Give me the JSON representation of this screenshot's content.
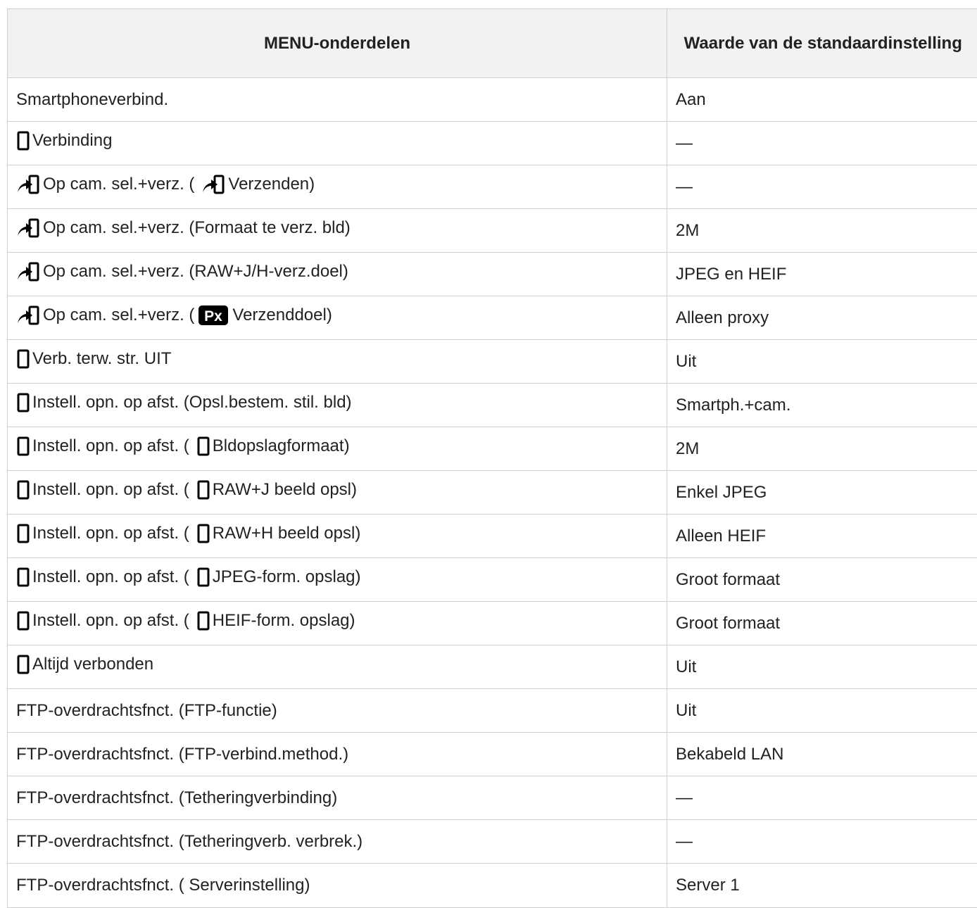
{
  "table": {
    "headers": [
      "MENU-onderdelen",
      "Waarde van de standaardinstelling"
    ],
    "rows": [
      {
        "parts": [
          {
            "t": "Smartphoneverbind."
          }
        ],
        "value": "Aan"
      },
      {
        "parts": [
          {
            "i": "phone"
          },
          {
            "t": "Verbinding"
          }
        ],
        "value": "—"
      },
      {
        "parts": [
          {
            "i": "send"
          },
          {
            "t": "Op cam. sel.+verz. ("
          },
          {
            "i": "send"
          },
          {
            "t": "Verzenden)"
          }
        ],
        "value": "—"
      },
      {
        "parts": [
          {
            "i": "send"
          },
          {
            "t": "Op cam. sel.+verz. (Formaat te verz. bld)"
          }
        ],
        "value": "2M"
      },
      {
        "parts": [
          {
            "i": "send"
          },
          {
            "t": "Op cam. sel.+verz. (RAW+J/H-verz.doel)"
          }
        ],
        "value": "JPEG en HEIF"
      },
      {
        "parts": [
          {
            "i": "send"
          },
          {
            "t": "Op cam. sel.+verz. ("
          },
          {
            "i": "px"
          },
          {
            "t": "Verzenddoel)"
          }
        ],
        "value": "Alleen proxy"
      },
      {
        "parts": [
          {
            "i": "phone"
          },
          {
            "t": "Verb. terw. str. UIT"
          }
        ],
        "value": "Uit"
      },
      {
        "parts": [
          {
            "i": "phone"
          },
          {
            "t": "Instell. opn. op afst. (Opsl.bestem. stil. bld)"
          }
        ],
        "value": "Smartph.+cam."
      },
      {
        "parts": [
          {
            "i": "phone"
          },
          {
            "t": "Instell. opn. op afst. ("
          },
          {
            "i": "phone"
          },
          {
            "t": "Bldopslagformaat)"
          }
        ],
        "value": "2M"
      },
      {
        "parts": [
          {
            "i": "phone"
          },
          {
            "t": "Instell. opn. op afst. ("
          },
          {
            "i": "phone"
          },
          {
            "t": "RAW+J beeld opsl)"
          }
        ],
        "value": "Enkel JPEG"
      },
      {
        "parts": [
          {
            "i": "phone"
          },
          {
            "t": "Instell. opn. op afst. ("
          },
          {
            "i": "phone"
          },
          {
            "t": "RAW+H beeld opsl)"
          }
        ],
        "value": "Alleen HEIF"
      },
      {
        "parts": [
          {
            "i": "phone"
          },
          {
            "t": "Instell. opn. op afst. ("
          },
          {
            "i": "phone"
          },
          {
            "t": "JPEG-form. opslag)"
          }
        ],
        "value": "Groot formaat"
      },
      {
        "parts": [
          {
            "i": "phone"
          },
          {
            "t": "Instell. opn. op afst. ("
          },
          {
            "i": "phone"
          },
          {
            "t": "HEIF-form. opslag)"
          }
        ],
        "value": "Groot formaat"
      },
      {
        "parts": [
          {
            "i": "phone"
          },
          {
            "t": "Altijd verbonden"
          }
        ],
        "value": "Uit"
      },
      {
        "parts": [
          {
            "t": "FTP-overdrachtsfnct. (FTP-functie)"
          }
        ],
        "value": "Uit"
      },
      {
        "parts": [
          {
            "t": "FTP-overdrachtsfnct. (FTP-verbind.method.)"
          }
        ],
        "value": "Bekabeld LAN"
      },
      {
        "parts": [
          {
            "t": "FTP-overdrachtsfnct. (Tetheringverbinding)"
          }
        ],
        "value": "—"
      },
      {
        "parts": [
          {
            "t": "FTP-overdrachtsfnct. (Tetheringverb. verbrek.)"
          }
        ],
        "value": "—"
      },
      {
        "parts": [
          {
            "t": "FTP-overdrachtsfnct. ( Serverinstelling)"
          }
        ],
        "value": "Server 1"
      }
    ]
  },
  "icons": {
    "phone": "smartphone-icon",
    "send": "send-to-smartphone-icon",
    "px": "proxy-icon"
  },
  "icon_labels": {
    "px": "Px"
  },
  "colors": {
    "header_bg": "#f2f2f2",
    "border": "#cfcfcf",
    "text": "#222222",
    "icon": "#000000"
  }
}
